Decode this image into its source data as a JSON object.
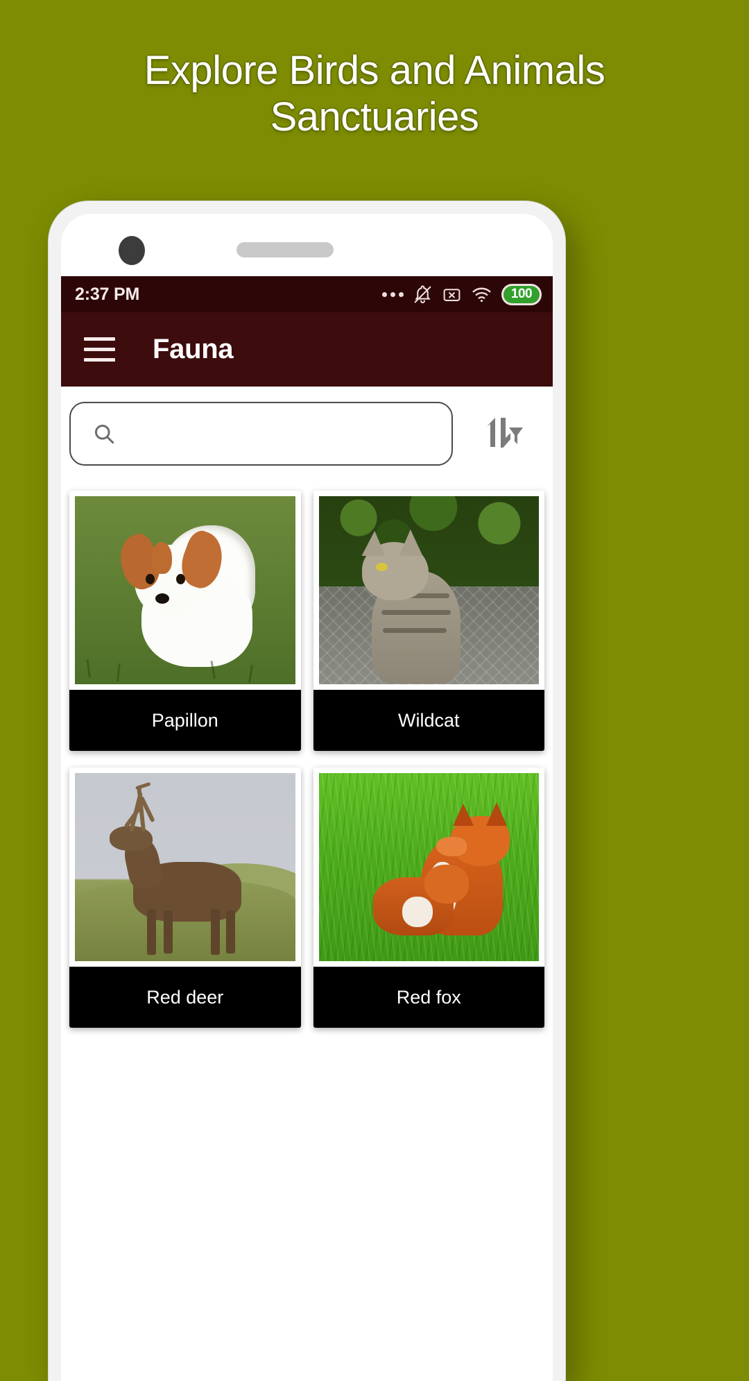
{
  "promo": {
    "headline": "Explore Birds and Animals\nSanctuaries",
    "background_color": "#7d8c02"
  },
  "phone": {
    "status_bar": {
      "time": "2:37 PM",
      "background_color": "#2d0708",
      "icons": [
        "more-dots-icon",
        "notifications-off-icon",
        "sim-disabled-icon",
        "wifi-icon"
      ],
      "battery": {
        "level": "100",
        "color": "#31a02c"
      }
    },
    "app_bar": {
      "menu_icon": "hamburger-menu-icon",
      "title": "Fauna",
      "background_color": "#3d0c0d"
    },
    "search": {
      "icon": "search-icon",
      "value": "",
      "placeholder": ""
    },
    "sort_button": {
      "icon": "sort-filter-icon",
      "label": "Sort and filter"
    },
    "cards": [
      {
        "name": "Papillon",
        "thumb": "papillon-photo",
        "scene": "sc-papillon"
      },
      {
        "name": "Wildcat",
        "thumb": "wildcat-photo",
        "scene": "sc-wildcat"
      },
      {
        "name": "Red deer",
        "thumb": "red-deer-photo",
        "scene": "sc-reddeer"
      },
      {
        "name": "Red fox",
        "thumb": "red-fox-photo",
        "scene": "sc-redfox"
      }
    ]
  }
}
